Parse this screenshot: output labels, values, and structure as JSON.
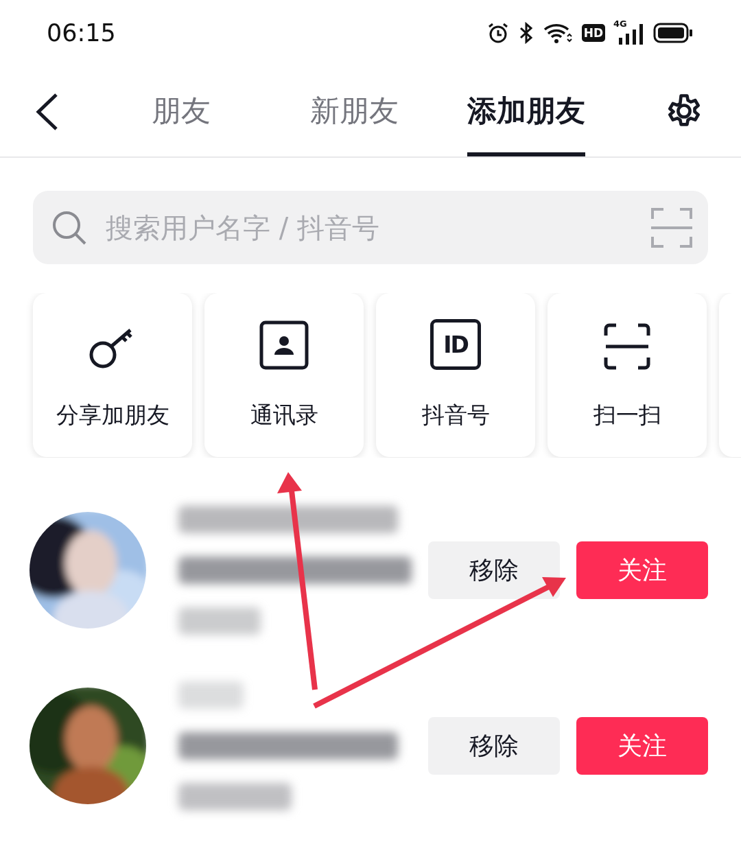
{
  "status_bar": {
    "time": "06:15",
    "hd_badge": "HD",
    "network": "4G"
  },
  "tabs": [
    {
      "label": "朋友",
      "selected": false
    },
    {
      "label": "新朋友",
      "selected": false
    },
    {
      "label": "添加朋友",
      "selected": true
    }
  ],
  "search": {
    "placeholder": "搜索用户名字 / 抖音号"
  },
  "shortcuts": [
    {
      "kind": "key",
      "label": "分享加朋友"
    },
    {
      "kind": "contacts",
      "label": "通讯录"
    },
    {
      "kind": "id",
      "label": "抖音号",
      "icon_text": "ID"
    },
    {
      "kind": "scan",
      "label": "扫一扫"
    }
  ],
  "suggestions": [
    {
      "kind": "picture",
      "remove_label": "移除",
      "follow_label": "关注"
    },
    {
      "kind": "picture",
      "remove_label": "移除",
      "follow_label": "关注"
    }
  ]
}
